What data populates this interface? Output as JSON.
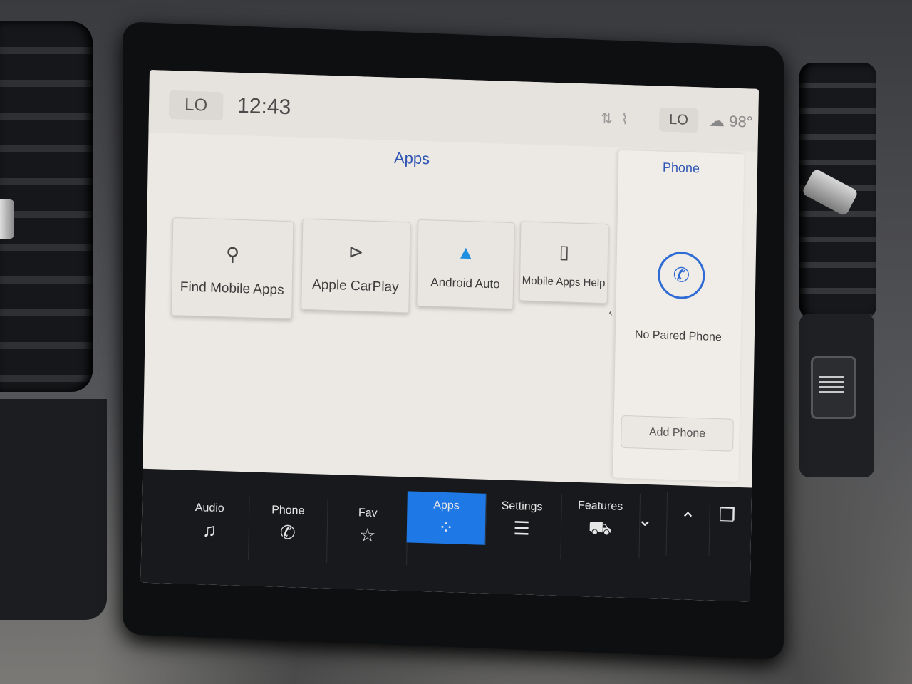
{
  "status_bar": {
    "climate_left": "LO",
    "time": "12:43",
    "climate_right": "LO",
    "outside_temp": "98°"
  },
  "apps": {
    "title": "Apps",
    "tiles": [
      {
        "label": "Find Mobile Apps",
        "icon": "search-apps-icon"
      },
      {
        "label": "Apple CarPlay",
        "icon": "carplay-icon"
      },
      {
        "label": "Android Auto",
        "icon": "android-auto-icon"
      },
      {
        "label": "Mobile Apps Help",
        "icon": "help-icon"
      }
    ]
  },
  "phone_panel": {
    "title": "Phone",
    "status": "No Paired Phone",
    "add_button": "Add Phone"
  },
  "nav": {
    "items": [
      {
        "label": "Audio",
        "icon": "music-note-icon"
      },
      {
        "label": "Phone",
        "icon": "phone-icon"
      },
      {
        "label": "Fav",
        "icon": "star-icon"
      },
      {
        "label": "Apps",
        "icon": "grid-icon",
        "active": true
      },
      {
        "label": "Settings",
        "icon": "sliders-icon"
      },
      {
        "label": "Features",
        "icon": "car-icon"
      }
    ]
  },
  "colors": {
    "accent": "#2f55b4",
    "active_tab": "#1e78e6",
    "screen_bg": "#ece8e3",
    "nav_bg": "#17191c"
  }
}
